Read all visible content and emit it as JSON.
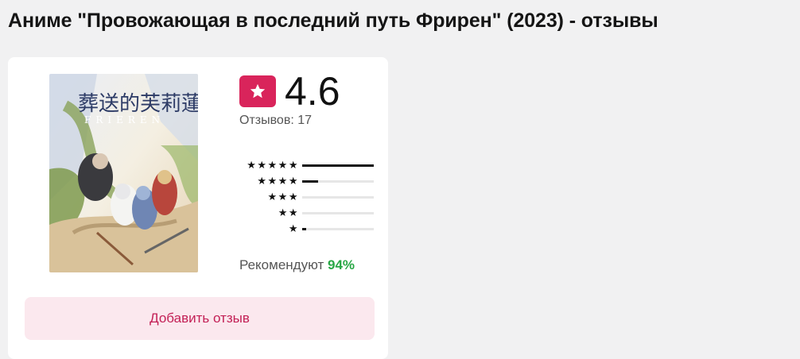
{
  "page": {
    "title": "Аниме \"Провожающая в последний путь Фрирен\" (2023) - отзывы"
  },
  "poster": {
    "title_jp": "葬送的芙莉蓮",
    "title_latin": "FRIEREN",
    "icon": "anime-poster-image"
  },
  "rating": {
    "value": "4.6",
    "badge_icon": "star-icon",
    "badge_color": "#d9245b",
    "reviews_label": "Отзывов:",
    "reviews_count": "17"
  },
  "distribution": [
    {
      "stars": "★★★★★",
      "fraction": 1.0
    },
    {
      "stars": "★★★★",
      "fraction": 0.22
    },
    {
      "stars": "★★★",
      "fraction": 0.0
    },
    {
      "stars": "★★",
      "fraction": 0.0
    },
    {
      "stars": "★",
      "fraction": 0.06
    }
  ],
  "recommend": {
    "label": "Рекомендуют",
    "percent": "94%",
    "percent_color": "#28a745"
  },
  "actions": {
    "add_review_label": "Добавить отзыв"
  }
}
